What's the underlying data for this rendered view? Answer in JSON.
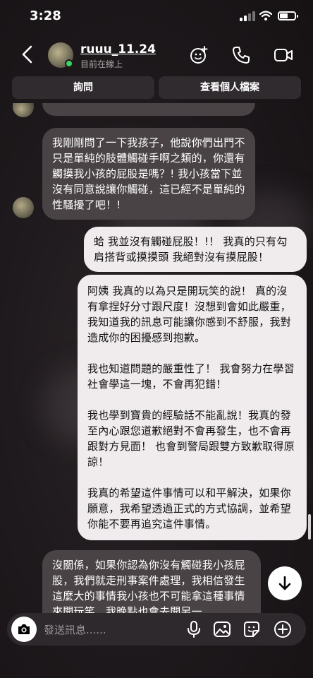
{
  "status_bar": {
    "time": "3:28"
  },
  "header": {
    "username": "ruuu_11.24",
    "status": "目前在線上"
  },
  "top_buttons": {
    "ask": "詢問",
    "profile": "查看個人檔案"
  },
  "messages": [
    {
      "side": "left",
      "text": "我剛剛問了一下我孩子，他說你們出門不只是單純的肢體觸碰手啊之類的，你還有觸摸我小孩的屁股是嗎？! 我小孩當下並沒有同意說讓你觸碰，這已經不是單純的性騷擾了吧！!"
    },
    {
      "side": "right",
      "text": "蛤 我並沒有觸碰屁股！!！ 我真的只有勾肩搭背或摸摸頭 我絕對沒有摸屁股！"
    },
    {
      "side": "right",
      "paragraphs": [
        "阿姨 我真的以為只是開玩笑的說！ 真的沒有拿捏好分寸跟尺度！沒想到會如此嚴重，我知道我的訊息可能讓你感到不舒服，我對造成你的困擾感到抱歉。",
        "我也知道問題的嚴重性了！ 我會努力在學習社會學這一塊，不會再犯錯！",
        "我也學到寶貴的經驗話不能亂說！我真的發至內心跟您道歉絕對不會再發生，也不會再跟對方見面！ 也會到警局跟雙方致歉取得原諒！",
        "我真的希望這件事情可以和平解決，如果你願意，我希望透過正式的方式協調，並希望你能不要再追究這件事情。"
      ]
    },
    {
      "side": "left",
      "text": "沒關係，如果你認為你沒有觸碰我小孩屁股，我們就走刑事案件處理，我相信發生這麼大的事情我小孩也不可能拿這種事情來開玩笑，我晚點也會去開另一"
    }
  ],
  "composer": {
    "placeholder": "發送訊息......"
  },
  "icons": {
    "back": "chevron-left-icon",
    "avatar_effects": "sticker-plus-icon",
    "call": "phone-icon",
    "video": "video-icon",
    "camera": "camera-icon",
    "mic": "microphone-icon",
    "gallery": "image-icon",
    "sticker": "sticker-icon",
    "add": "plus-circle-icon",
    "scroll_down": "arrow-down-icon"
  },
  "colors": {
    "background": "#1f1a1d",
    "left_bubble": "#4a4346",
    "right_bubble": "#f0ebed",
    "online": "#3ad167"
  }
}
